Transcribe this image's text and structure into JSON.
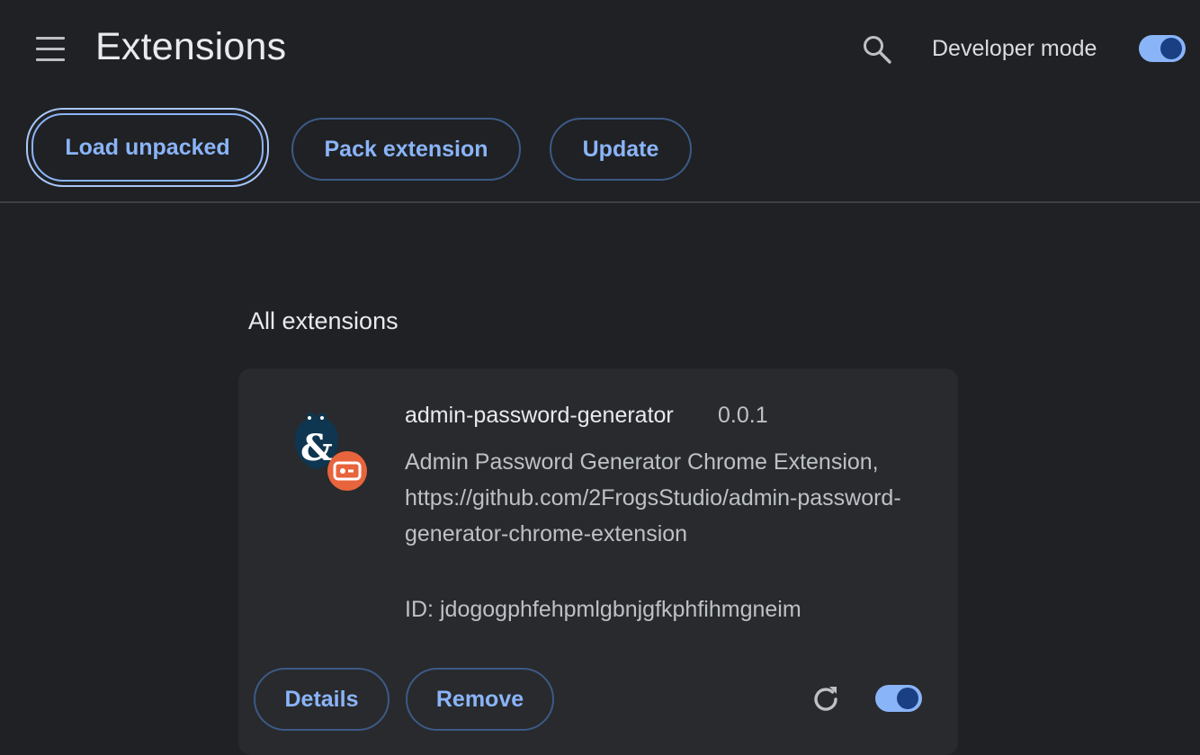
{
  "header": {
    "title": "Extensions",
    "developer_mode_label": "Developer mode",
    "developer_mode_on": true,
    "icons": {
      "menu": "hamburger-menu-icon",
      "search": "search-icon"
    }
  },
  "toolbar": {
    "load_unpacked_label": "Load unpacked",
    "pack_extension_label": "Pack extension",
    "update_label": "Update"
  },
  "section": {
    "title": "All extensions"
  },
  "extension": {
    "name": "admin-password-generator",
    "version": "0.0.1",
    "description": "Admin Password Generator Chrome Extension, https://github.com/2FrogsStudio/admin-password-generator-chrome-extension",
    "id_label": "ID:",
    "id_value": "jdogogphfehpmlgbnjgfkphfihmgneim",
    "details_label": "Details",
    "remove_label": "Remove",
    "enabled": true,
    "icons": {
      "extension": "extension-logo-icon",
      "badge": "unpacked-badge-icon",
      "reload": "reload-icon"
    }
  },
  "colors": {
    "background": "#202124",
    "card": "#292a2d",
    "accent": "#8ab4f8",
    "toggle_knob": "#1a3f82",
    "badge": "#e8643c"
  }
}
